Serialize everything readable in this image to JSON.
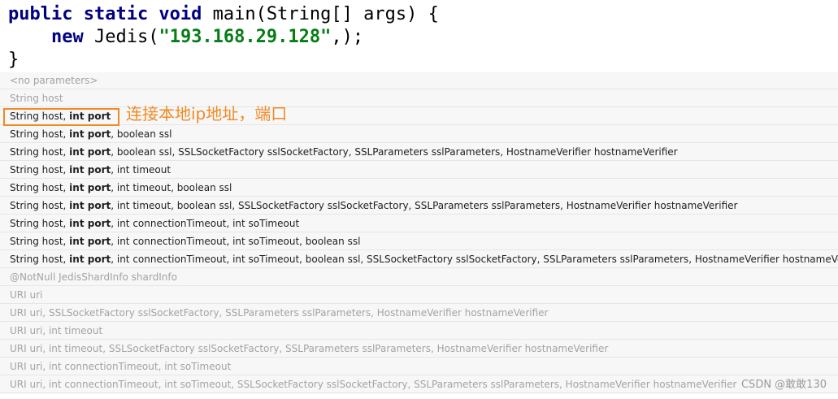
{
  "code": {
    "line1": {
      "kw1": "public static void",
      "rest": " main(String[] args) {"
    },
    "line2": {
      "indent": "    ",
      "kw": "new",
      "mid": " Jedis(",
      "str": "\"193.168.29.128\"",
      "end": ",);"
    },
    "line3": "}"
  },
  "popup": {
    "rows": [
      {
        "pre": "<no parameters>",
        "bold": "",
        "post": "",
        "dim": true
      },
      {
        "pre": "String host",
        "bold": "",
        "post": "",
        "dim": true
      },
      {
        "pre": "String host, ",
        "bold": "int port",
        "post": "",
        "dim": false
      },
      {
        "pre": "String host, ",
        "bold": "int port",
        "post": ", boolean ssl",
        "dim": false
      },
      {
        "pre": "String host, ",
        "bold": "int port",
        "post": ", boolean ssl, SSLSocketFactory sslSocketFactory, SSLParameters sslParameters, HostnameVerifier hostnameVerifier",
        "dim": false
      },
      {
        "pre": "String host, ",
        "bold": "int port",
        "post": ", int timeout",
        "dim": false
      },
      {
        "pre": "String host, ",
        "bold": "int port",
        "post": ", int timeout, boolean ssl",
        "dim": false
      },
      {
        "pre": "String host, ",
        "bold": "int port",
        "post": ", int timeout, boolean ssl, SSLSocketFactory sslSocketFactory, SSLParameters sslParameters, HostnameVerifier hostnameVerifier",
        "dim": false
      },
      {
        "pre": "String host, ",
        "bold": "int port",
        "post": ", int connectionTimeout, int soTimeout",
        "dim": false
      },
      {
        "pre": "String host, ",
        "bold": "int port",
        "post": ", int connectionTimeout, int soTimeout, boolean ssl",
        "dim": false
      },
      {
        "pre": "String host, ",
        "bold": "int port",
        "post": ", int connectionTimeout, int soTimeout, boolean ssl, SSLSocketFactory sslSocketFactory, SSLParameters sslParameters, HostnameVerifier hostnameVerifier",
        "dim": false
      },
      {
        "pre": "@NotNull JedisShardInfo shardInfo",
        "bold": "",
        "post": "",
        "dim": true
      },
      {
        "pre": "URI uri",
        "bold": "",
        "post": "",
        "dim": true
      },
      {
        "pre": "URI uri, SSLSocketFactory sslSocketFactory, SSLParameters sslParameters, HostnameVerifier hostnameVerifier",
        "bold": "",
        "post": "",
        "dim": true
      },
      {
        "pre": "URI uri, int timeout",
        "bold": "",
        "post": "",
        "dim": true
      },
      {
        "pre": "URI uri, int timeout, SSLSocketFactory sslSocketFactory, SSLParameters sslParameters, HostnameVerifier hostnameVerifier",
        "bold": "",
        "post": "",
        "dim": true
      },
      {
        "pre": "URI uri, int connectionTimeout, int soTimeout",
        "bold": "",
        "post": "",
        "dim": true
      },
      {
        "pre": "URI uri, int connectionTimeout, int soTimeout, SSLSocketFactory sslSocketFactory, SSLParameters sslParameters, HostnameVerifier hostnameVerifier",
        "bold": "",
        "post": "",
        "dim": true
      }
    ]
  },
  "annotation": {
    "text": "连接本地ip地址，端口",
    "color": "#f08a24"
  },
  "watermark": "CSDN @敢敢130"
}
